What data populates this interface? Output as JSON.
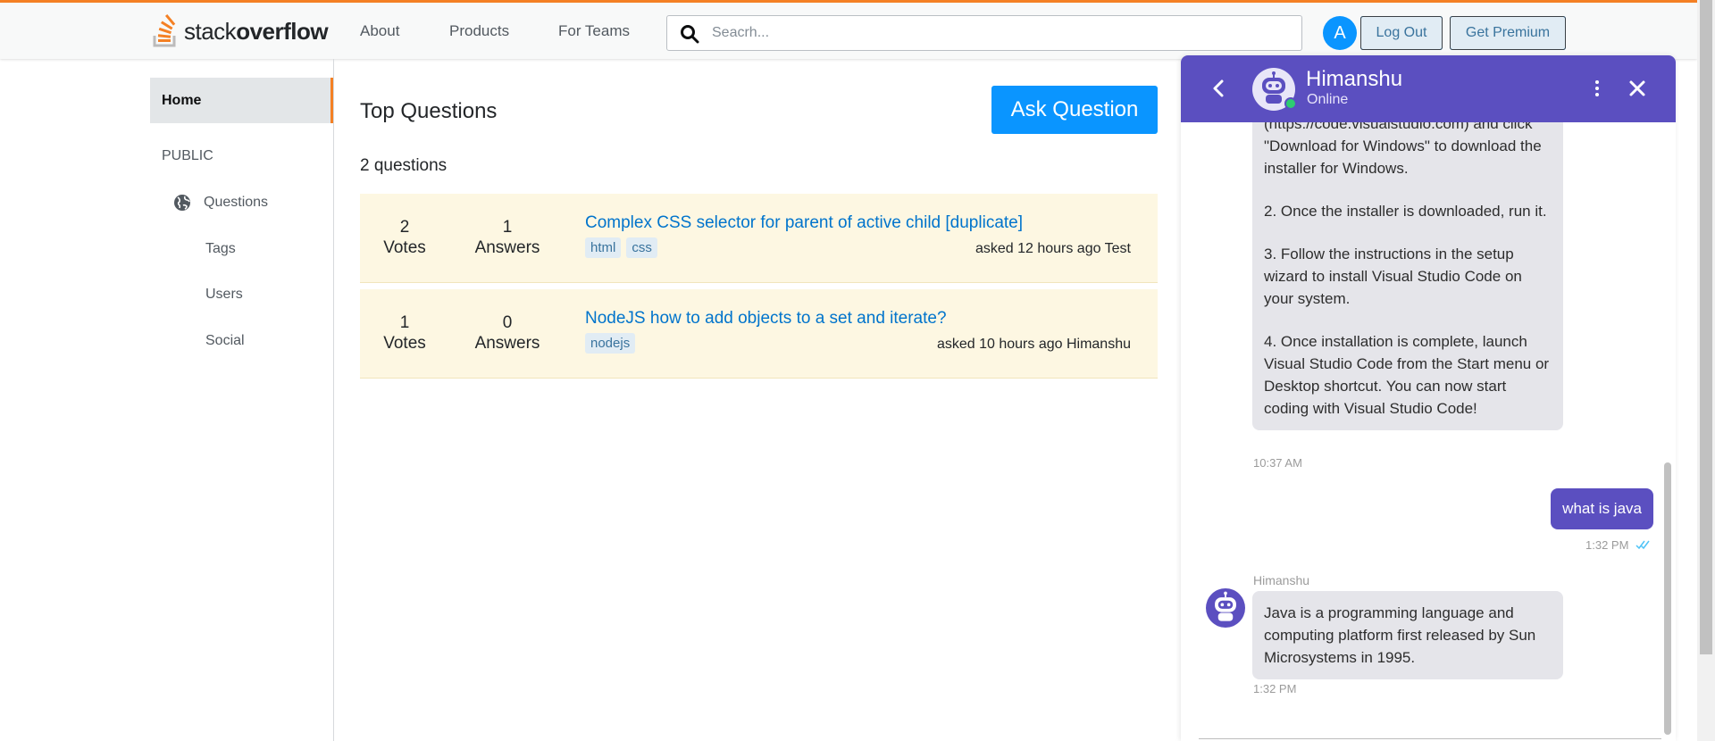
{
  "brand": {
    "logo_light": "stack",
    "logo_bold": "overflow",
    "accent_color": "#f48024",
    "link_color": "#0074cc",
    "primary_color": "#0a95ff",
    "chat_color": "#5b4fc0"
  },
  "topnav": {
    "links": [
      "About",
      "Products",
      "For Teams"
    ],
    "search_placeholder": "Seacrh...",
    "avatar_letter": "A",
    "logout_label": "Log Out",
    "premium_label": "Get Premium"
  },
  "sidebar": {
    "home_label": "Home",
    "section_label": "PUBLIC",
    "items": [
      "Questions",
      "Tags",
      "Users",
      "Social"
    ]
  },
  "main": {
    "title": "Top Questions",
    "ask_button": "Ask Question",
    "count_text": "2 questions",
    "questions": [
      {
        "votes": "2",
        "votes_label": "Votes",
        "answers": "1",
        "answers_label": "Answers",
        "title": "Complex CSS selector for parent of active child [duplicate]",
        "tags": [
          "html",
          "css"
        ],
        "meta": "asked 12 hours ago Test"
      },
      {
        "votes": "1",
        "votes_label": "Votes",
        "answers": "0",
        "answers_label": "Answers",
        "title": "NodeJS how to add objects to a set and iterate?",
        "tags": [
          "nodejs"
        ],
        "meta": "asked 10 hours ago Himanshu"
      }
    ]
  },
  "chat": {
    "name": "Himanshu",
    "status": "Online",
    "messages": [
      {
        "from": "bot",
        "lines": [
          "(https://code.visualstudio.com) and click \"Download for Windows\" to download the installer for Windows.",
          "2. Once the installer is downloaded, run it.",
          "3. Follow the instructions in the setup wizard to install Visual Studio Code on your system.",
          "4. Once installation is complete, launch Visual Studio Code from the Start menu or Desktop shortcut. You can now start coding with Visual Studio Code!"
        ],
        "time": "10:37 AM"
      },
      {
        "from": "user",
        "text": "what is java",
        "time": "1:32 PM"
      },
      {
        "from": "bot",
        "sender": "Himanshu",
        "text": "Java is a programming language and computing platform first released by Sun Microsystems in 1995.",
        "time": "1:32 PM"
      }
    ]
  }
}
